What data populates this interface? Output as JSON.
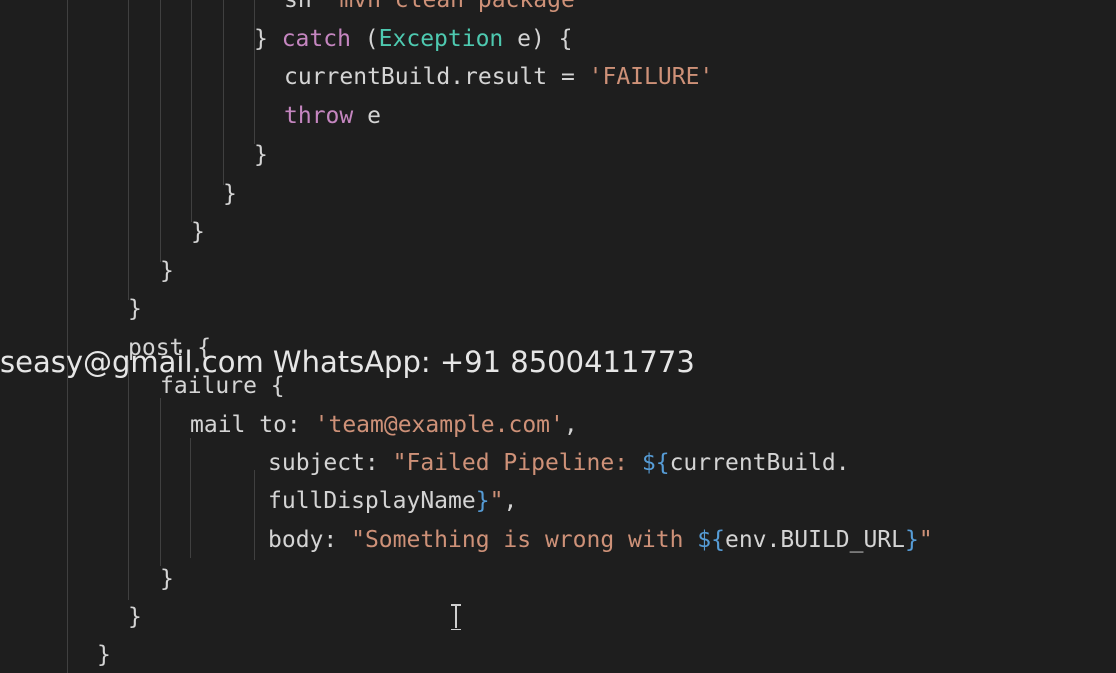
{
  "editor": {
    "lines": [
      {
        "segments": [
          {
            "c": "code-text",
            "t": "sh "
          },
          {
            "c": "str",
            "t": "'mvn clean package'"
          }
        ]
      },
      {
        "segments": [
          {
            "c": "code-text",
            "t": "} "
          },
          {
            "c": "kw",
            "t": "catch"
          },
          {
            "c": "code-text",
            "t": " ("
          },
          {
            "c": "type",
            "t": "Exception"
          },
          {
            "c": "code-text",
            "t": " e) {"
          }
        ]
      },
      {
        "segments": [
          {
            "c": "code-text",
            "t": "currentBuild.result = "
          },
          {
            "c": "str",
            "t": "'FAILURE'"
          }
        ]
      },
      {
        "segments": [
          {
            "c": "kw",
            "t": "throw"
          },
          {
            "c": "code-text",
            "t": " e"
          }
        ]
      },
      {
        "segments": [
          {
            "c": "code-text",
            "t": "}"
          }
        ]
      },
      {
        "segments": [
          {
            "c": "code-text",
            "t": "}"
          }
        ]
      },
      {
        "segments": [
          {
            "c": "code-text",
            "t": "}"
          }
        ]
      },
      {
        "segments": [
          {
            "c": "code-text",
            "t": "}"
          }
        ]
      },
      {
        "segments": [
          {
            "c": "code-text",
            "t": "}"
          }
        ]
      },
      {
        "segments": [
          {
            "c": "code-text",
            "t": "post {"
          }
        ]
      },
      {
        "segments": [
          {
            "c": "code-text",
            "t": "failure {"
          }
        ]
      },
      {
        "segments": [
          {
            "c": "code-text",
            "t": "mail to: "
          },
          {
            "c": "str",
            "t": "'team@example.com'"
          },
          {
            "c": "code-text",
            "t": ","
          }
        ]
      },
      {
        "segments": [
          {
            "c": "code-text",
            "t": "subject: "
          },
          {
            "c": "str",
            "t": "\"Failed Pipeline: "
          },
          {
            "c": "interp",
            "t": "${"
          },
          {
            "c": "code-text",
            "t": "currentBuild."
          }
        ]
      },
      {
        "segments": [
          {
            "c": "code-text",
            "t": "fullDisplayName"
          },
          {
            "c": "interp",
            "t": "}"
          },
          {
            "c": "str",
            "t": "\""
          },
          {
            "c": "code-text",
            "t": ","
          }
        ]
      },
      {
        "segments": [
          {
            "c": "code-text",
            "t": "body: "
          },
          {
            "c": "str",
            "t": "\"Something is wrong with "
          },
          {
            "c": "interp",
            "t": "${"
          },
          {
            "c": "code-text",
            "t": "env.BUILD_URL"
          },
          {
            "c": "interp",
            "t": "}"
          },
          {
            "c": "str",
            "t": "\""
          }
        ]
      },
      {
        "segments": [
          {
            "c": "code-text",
            "t": "}"
          }
        ]
      },
      {
        "segments": [
          {
            "c": "code-text",
            "t": "}"
          }
        ]
      },
      {
        "segments": [
          {
            "c": "code-text",
            "t": "}"
          }
        ]
      }
    ]
  },
  "overlay": {
    "watermark": "seasy@gmail.com WhatsApp: +91 8500411773"
  },
  "colors": {
    "background": "#1e1e1e",
    "text": "#d4d4d4",
    "keyword": "#c586c0",
    "type": "#4ec9b0",
    "string": "#ce9178",
    "interpolation": "#569cd6"
  },
  "icons": {
    "cursor": "text-cursor-icon"
  }
}
